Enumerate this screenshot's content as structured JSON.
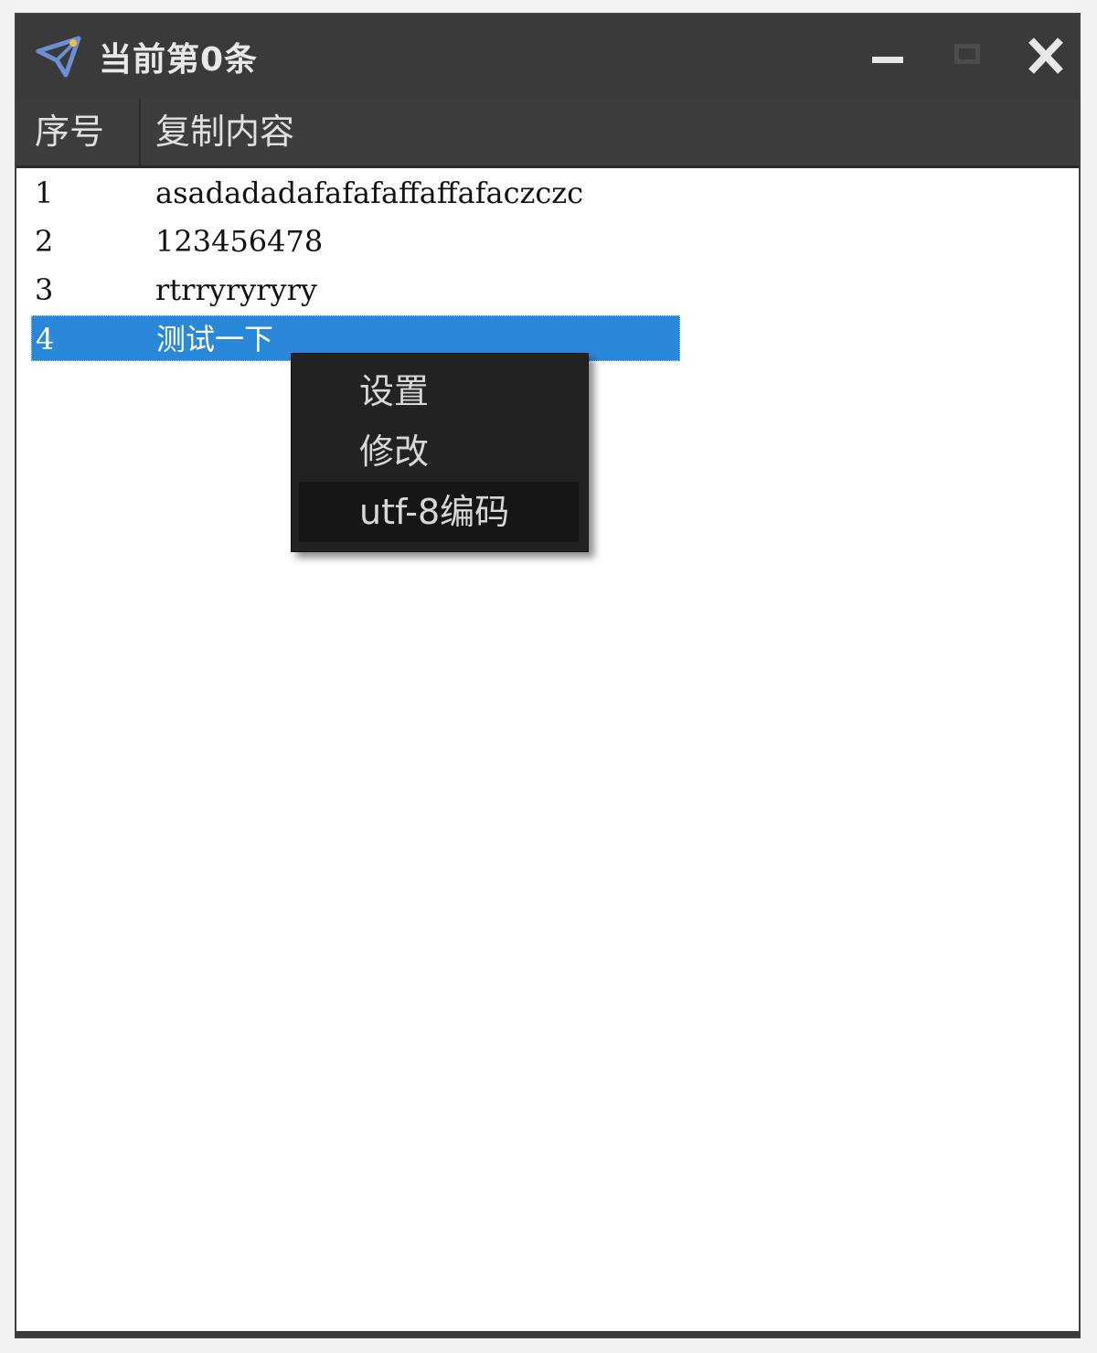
{
  "window": {
    "title": "当前第0条",
    "icon": "paper-plane-icon",
    "buttons": [
      "minimize-icon",
      "maximize-icon",
      "close-icon"
    ]
  },
  "list": {
    "columns": [
      "序号",
      "复制内容"
    ],
    "rows": [
      {
        "index": "1",
        "content": "asadadadafafafaffaffafaczczc"
      },
      {
        "index": "2",
        "content": "123456478"
      },
      {
        "index": "3",
        "content": "rtrryryryry"
      },
      {
        "index": "4",
        "content": "测试一下",
        "selected": true
      }
    ]
  },
  "context_menu": {
    "items": [
      "设置",
      "修改",
      "utf-8编码"
    ],
    "highlighted_index": 2
  },
  "colors": {
    "titlebar": "#3a3a3a",
    "selection": "#2a88da",
    "menu_bg": "#222222"
  }
}
